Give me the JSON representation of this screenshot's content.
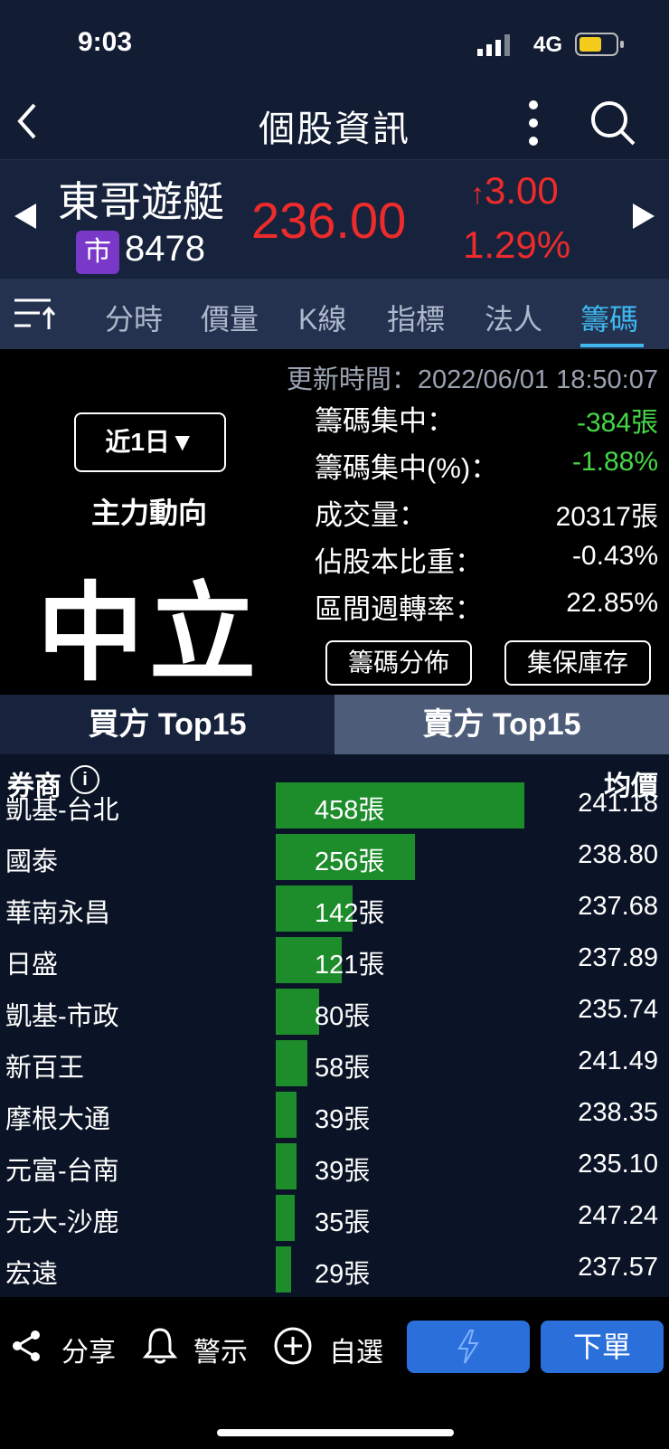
{
  "status_bar": {
    "time": "9:03",
    "network": "4G"
  },
  "nav": {
    "title": "個股資訊"
  },
  "stock": {
    "name": "東哥遊艇",
    "market_badge": "市",
    "code": "8478",
    "price": "236.00",
    "change": "3.00",
    "change_pct": "1.29%"
  },
  "tabs": [
    {
      "label": "分時"
    },
    {
      "label": "價量"
    },
    {
      "label": "K線"
    },
    {
      "label": "指標"
    },
    {
      "label": "法人"
    },
    {
      "label": "籌碼"
    }
  ],
  "info": {
    "update_time": "更新時間：2022/06/01 18:50:07",
    "period_button": "近1日▼",
    "main_force_label": "主力動向",
    "main_force_value": "中立",
    "stats": [
      {
        "label": "籌碼集中：",
        "value": "-384張"
      },
      {
        "label": "籌碼集中(%)：",
        "value": "-1.88%"
      },
      {
        "label": "成交量：",
        "value": "20317張"
      },
      {
        "label": "佔股本比重：",
        "value": "-0.43%"
      },
      {
        "label": "區間週轉率：",
        "value": "22.85%"
      }
    ],
    "buttons": {
      "distribution": "籌碼分佈",
      "custody": "集保庫存"
    }
  },
  "side_tabs": {
    "buy": "買方 Top15",
    "sell": "賣方 Top15"
  },
  "table": {
    "col_broker": "券商",
    "col_avg": "均價",
    "max_volume": 458,
    "rows": [
      {
        "broker": "凱基-台北",
        "volume": 458,
        "volume_label": "458張",
        "avg": "241.18"
      },
      {
        "broker": "國泰",
        "volume": 256,
        "volume_label": "256張",
        "avg": "238.80"
      },
      {
        "broker": "華南永昌",
        "volume": 142,
        "volume_label": "142張",
        "avg": "237.68"
      },
      {
        "broker": "日盛",
        "volume": 121,
        "volume_label": "121張",
        "avg": "237.89"
      },
      {
        "broker": "凱基-市政",
        "volume": 80,
        "volume_label": "80張",
        "avg": "235.74"
      },
      {
        "broker": "新百王",
        "volume": 58,
        "volume_label": "58張",
        "avg": "241.49"
      },
      {
        "broker": "摩根大通",
        "volume": 39,
        "volume_label": "39張",
        "avg": "238.35"
      },
      {
        "broker": "元富-台南",
        "volume": 39,
        "volume_label": "39張",
        "avg": "235.10"
      },
      {
        "broker": "元大-沙鹿",
        "volume": 35,
        "volume_label": "35張",
        "avg": "247.24"
      },
      {
        "broker": "宏遠",
        "volume": 29,
        "volume_label": "29張",
        "avg": "237.57"
      }
    ]
  },
  "bottom_bar": {
    "share": "分享",
    "alert": "警示",
    "watchlist": "自選",
    "order": "下單"
  },
  "colors": {
    "up": "#ee2b2b",
    "down": "#46d646",
    "accent": "#3fb7ef",
    "bar": "#1d8c2b",
    "button": "#2b6fdb"
  }
}
